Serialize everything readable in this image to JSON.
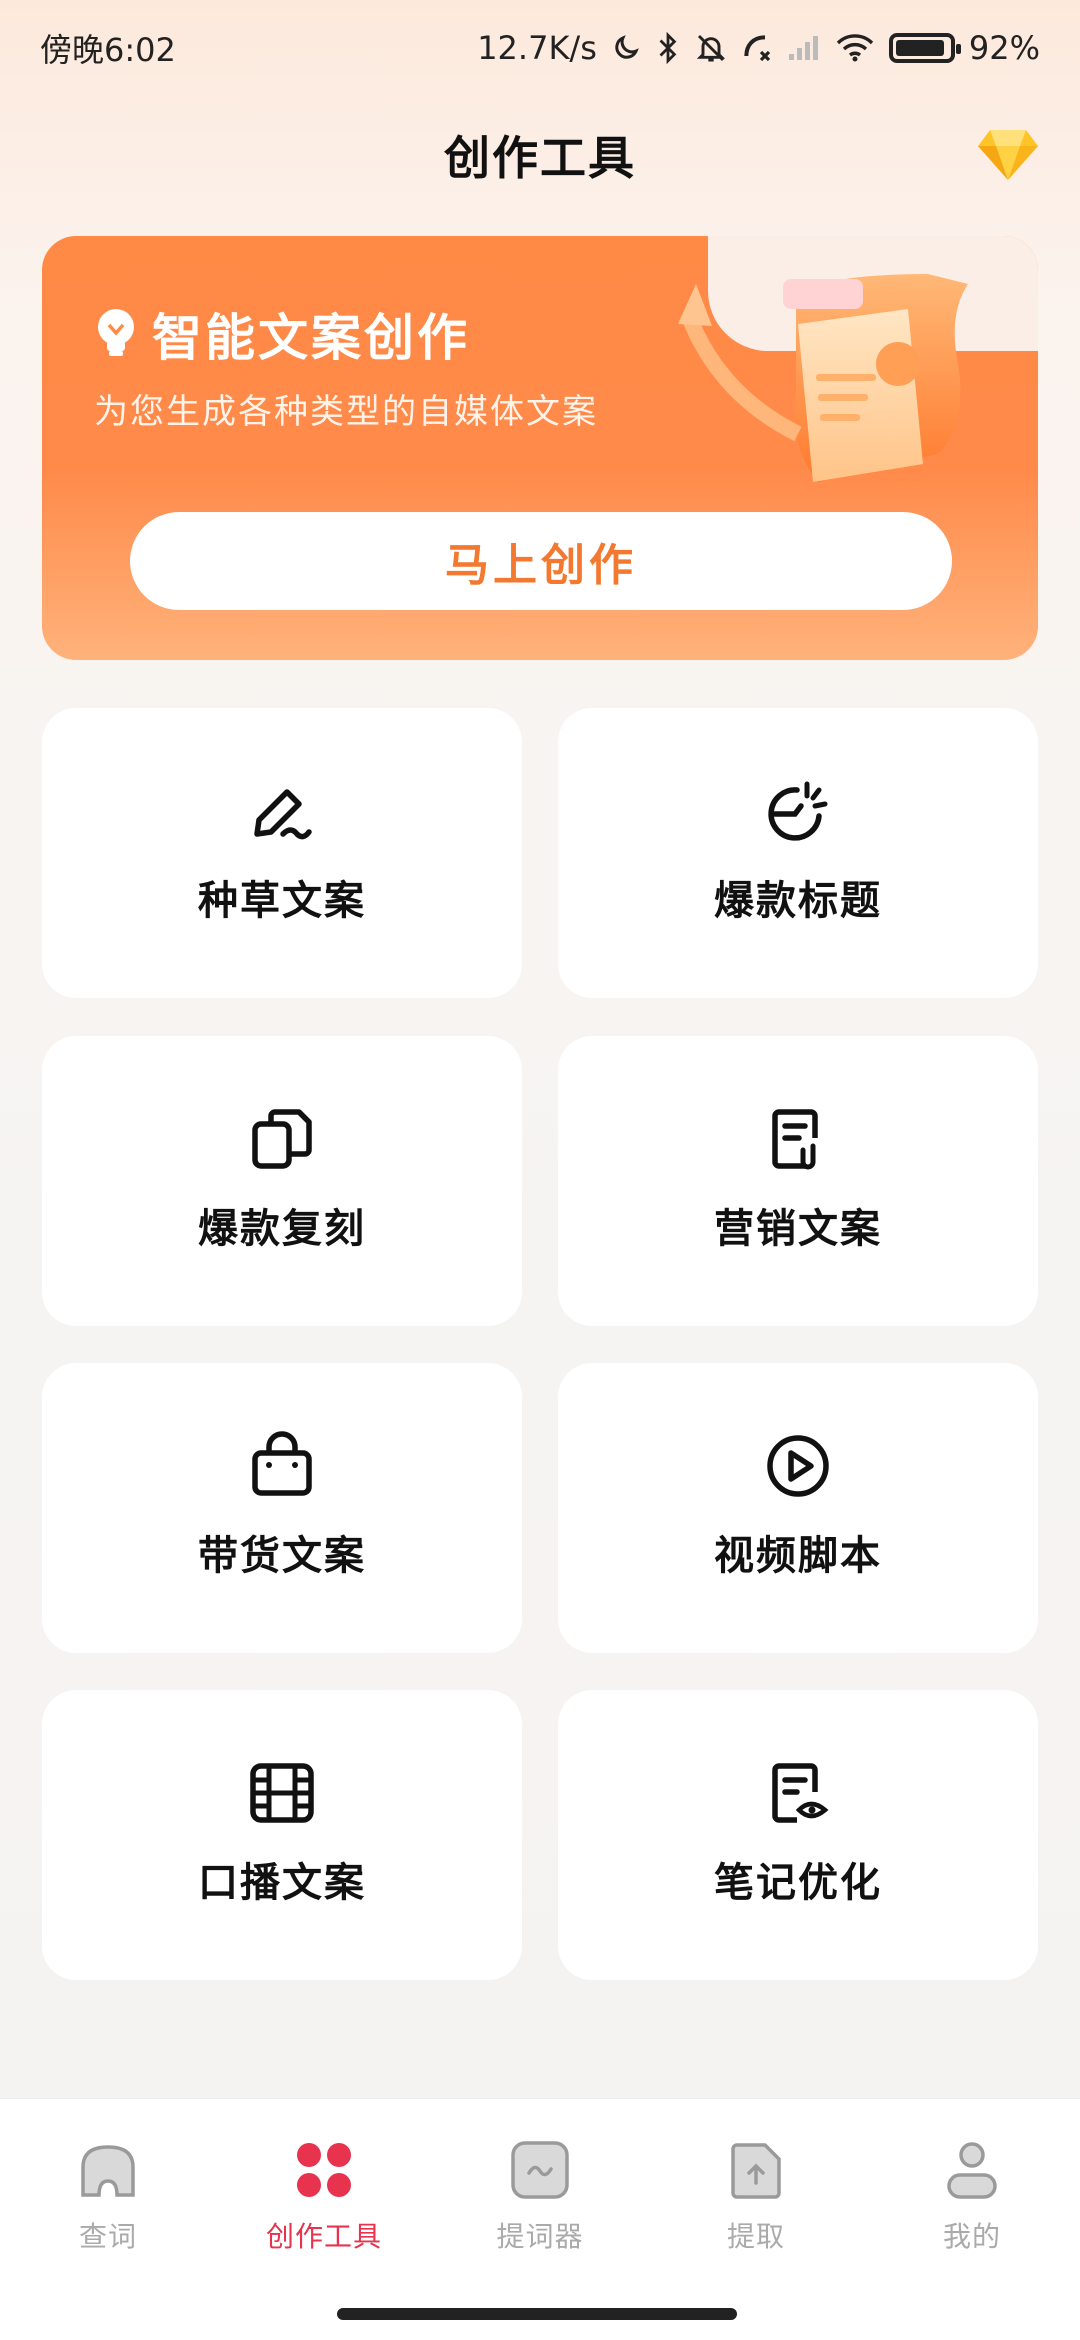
{
  "status_bar": {
    "time": "傍晚6:02",
    "speed": "12.7K/s",
    "battery": "92%",
    "battery_level": 0.92
  },
  "header": {
    "title": "创作工具",
    "vip_icon": "diamond-icon"
  },
  "hero": {
    "title": "智能文案创作",
    "subtitle": "为您生成各种类型的自媒体文案",
    "button": "马上创作",
    "colors": {
      "start": "#ff8a46",
      "end": "#ffb27b",
      "button_text": "#f2792f"
    }
  },
  "tools": [
    {
      "label": "种草文案",
      "icon": "pen-sign-icon"
    },
    {
      "label": "爆款标题",
      "icon": "explosion-chart-icon"
    },
    {
      "label": "爆款复刻",
      "icon": "copy-icon"
    },
    {
      "label": "营销文案",
      "icon": "document-clip-icon"
    },
    {
      "label": "带货文案",
      "icon": "shopping-bag-icon"
    },
    {
      "label": "视频脚本",
      "icon": "play-circle-icon"
    },
    {
      "label": "口播文案",
      "icon": "film-icon"
    },
    {
      "label": "笔记优化",
      "icon": "document-eye-icon"
    }
  ],
  "bottom_nav": [
    {
      "label": "查词",
      "icon": "home-icon",
      "active": false
    },
    {
      "label": "创作工具",
      "icon": "dots-grid-icon",
      "active": true
    },
    {
      "label": "提词器",
      "icon": "teleprompter-icon",
      "active": false
    },
    {
      "label": "提取",
      "icon": "extract-icon",
      "active": false
    },
    {
      "label": "我的",
      "icon": "user-icon",
      "active": false
    }
  ],
  "accent_color": "#e8334f"
}
